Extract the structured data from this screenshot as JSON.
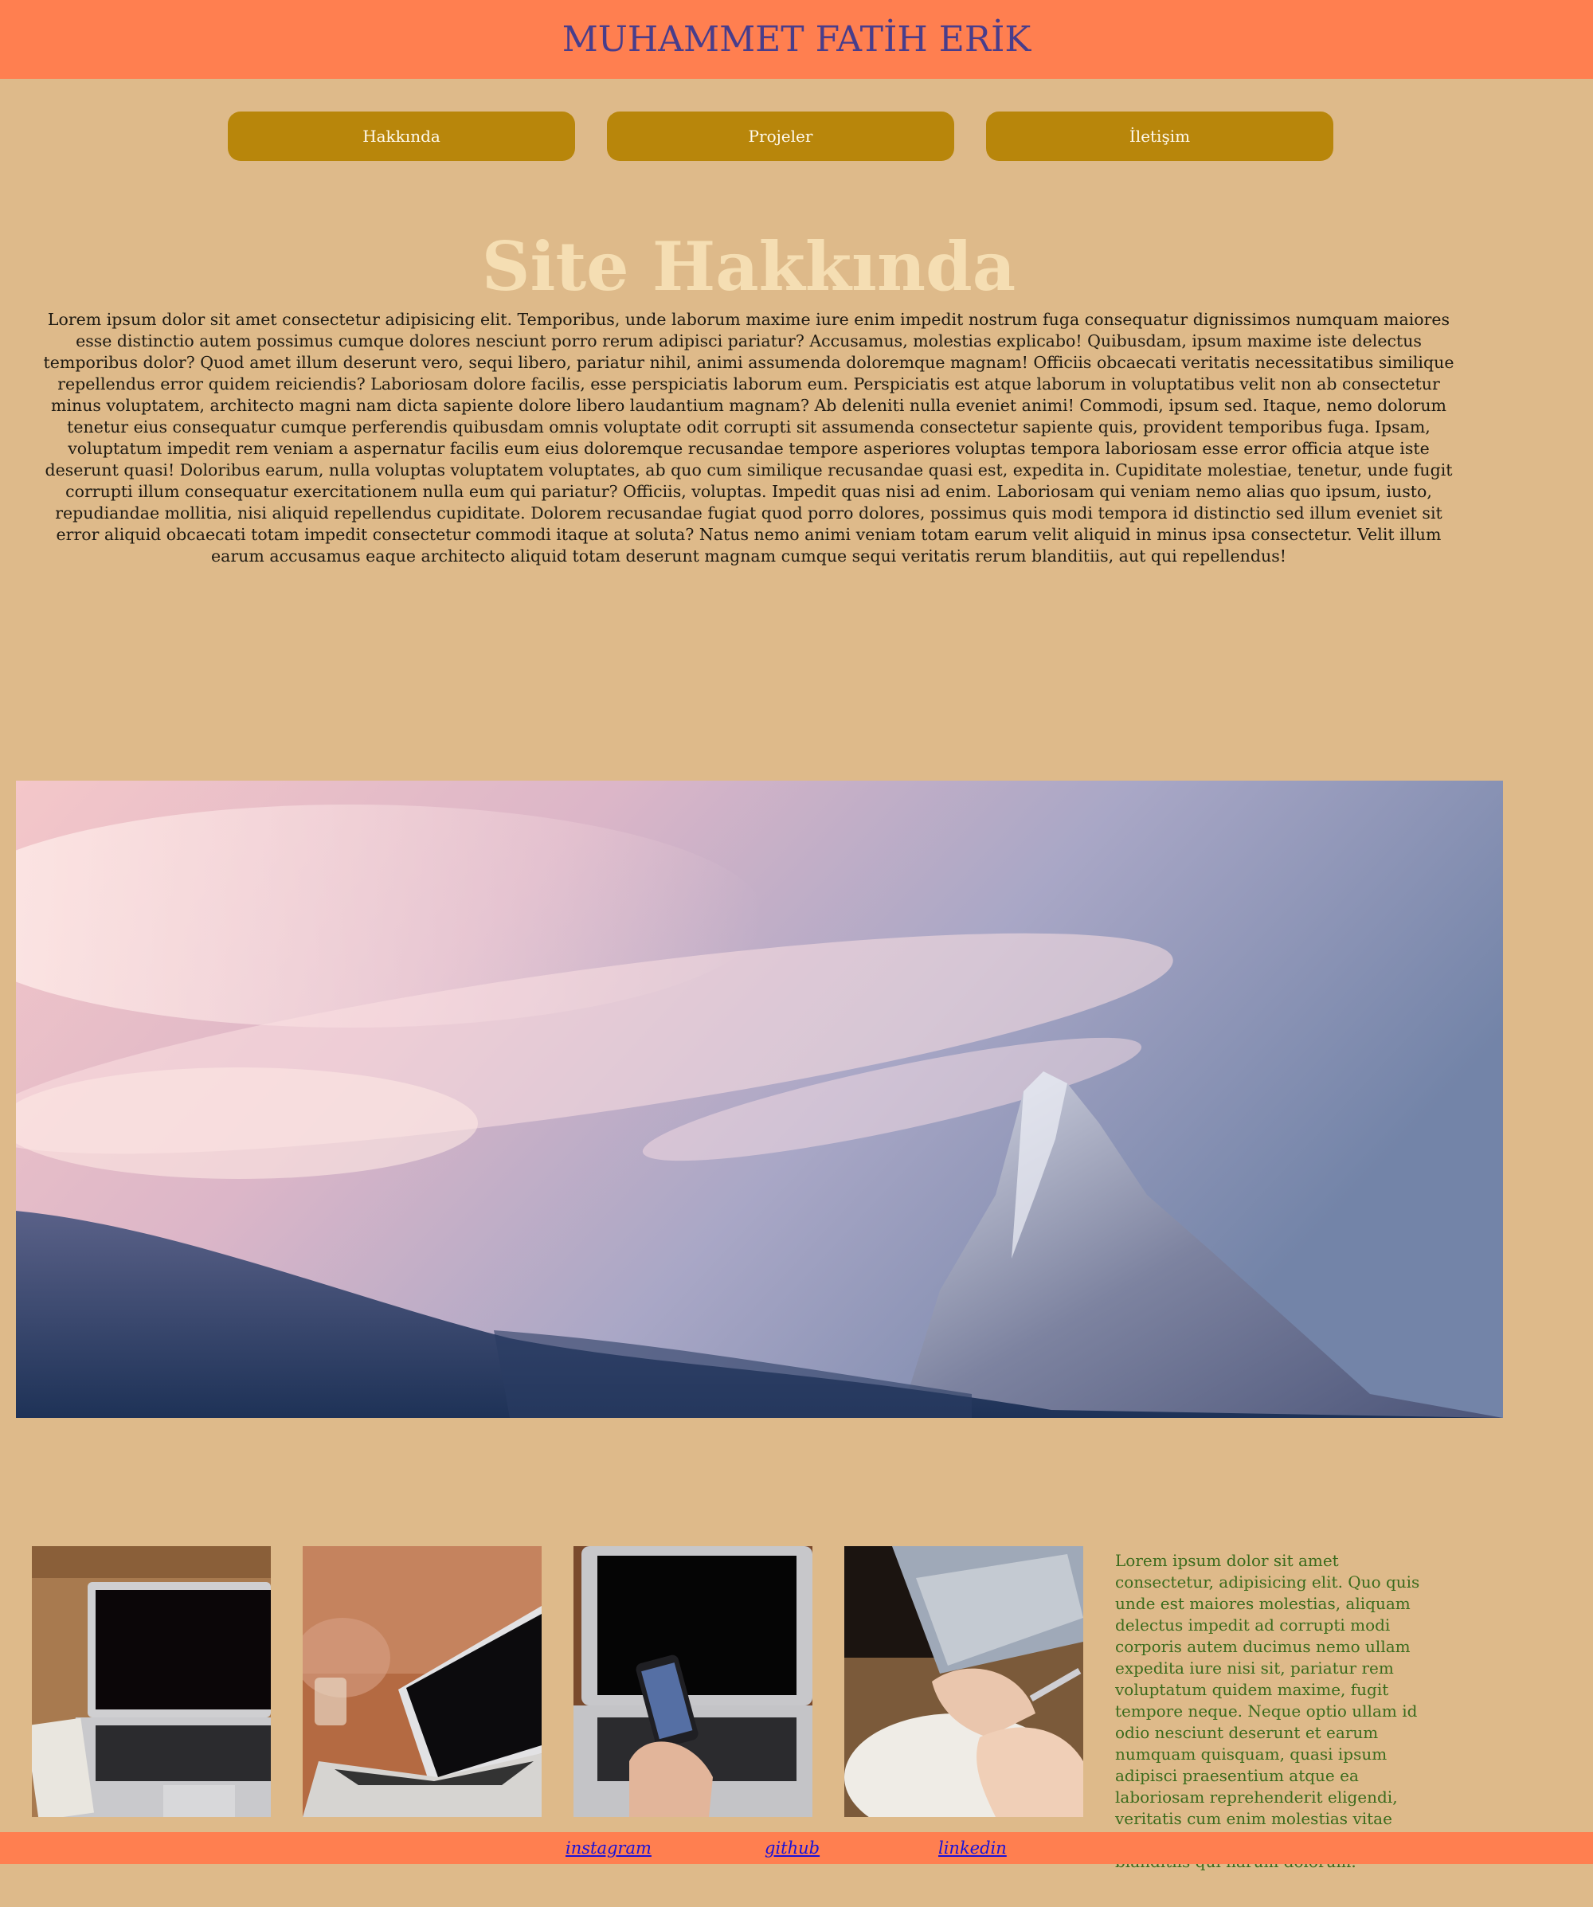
{
  "header": {
    "title": "MUHAMMET FATİH ERİK"
  },
  "nav": [
    {
      "label": "Hakkında"
    },
    {
      "label": "Projeler"
    },
    {
      "label": "İletişim"
    }
  ],
  "about": {
    "heading": "Site Hakkında",
    "body": "Lorem ipsum dolor sit amet consectetur adipisicing elit. Temporibus, unde laborum maxime iure enim impedit nostrum fuga consequatur dignissimos numquam maiores esse distinctio autem possimus cumque dolores nesciunt porro rerum adipisci pariatur? Accusamus, molestias explicabo! Quibusdam, ipsum maxime iste delectus temporibus dolor? Quod amet illum deserunt vero, sequi libero, pariatur nihil, animi assumenda doloremque magnam! Officiis obcaecati veritatis necessitatibus similique repellendus error quidem reiciendis? Laboriosam dolore facilis, esse perspiciatis laborum eum. Perspiciatis est atque laborum in voluptatibus velit non ab consectetur minus voluptatem, architecto magni nam dicta sapiente dolore libero laudantium magnam? Ab deleniti nulla eveniet animi! Commodi, ipsum sed. Itaque, nemo dolorum tenetur eius consequatur cumque perferendis quibusdam omnis voluptate odit corrupti sit assumenda consectetur sapiente quis, provident temporibus fuga. Ipsam, voluptatum impedit rem veniam a aspernatur facilis eum eius doloremque recusandae tempore asperiores voluptas tempora laboriosam esse error officia atque iste deserunt quasi! Doloribus earum, nulla voluptas voluptatem voluptates, ab quo cum similique recusandae quasi est, expedita in. Cupiditate molestiae, tenetur, unde fugit corrupti illum consequatur exercitationem nulla eum qui pariatur? Officiis, voluptas. Impedit quas nisi ad enim. Laboriosam qui veniam nemo alias quo ipsum, iusto, repudiandae mollitia, nisi aliquid repellendus cupiditate. Dolorem recusandae fugiat quod porro dolores, possimus quis modi tempora id distinctio sed illum eveniet sit error aliquid obcaecati totam impedit consectetur commodi itaque at soluta? Natus nemo animi veniam totam earum velit aliquid in minus ipsa consectetur. Velit illum earum accusamus eaque architecto aliquid totam deserunt magnam cumque sequi veritatis rerum blanditiis, aut qui repellendus!"
  },
  "gallery": {
    "side_text": "Lorem ipsum dolor sit amet consectetur, adipisicing elit. Quo quis unde est maiores molestias, aliquam delectus impedit ad corrupti modi corporis autem ducimus nemo ullam expedita iure nisi sit, pariatur rem voluptatum quidem maxime, fugit tempore neque. Neque optio ullam id odio nesciunt deserunt et earum numquam quisquam, quasi ipsum adipisci praesentium atque ea laboriosam reprehenderit eligendi, veritatis cum enim molestias vitae harum doloribus. Deserunt pariatur blanditiis qui harum dolorum."
  },
  "footer": {
    "links": [
      {
        "label": "instagram"
      },
      {
        "label": "github"
      },
      {
        "label": "linkedin"
      }
    ]
  },
  "colors": {
    "header_bg": "#FF7F50",
    "page_bg": "#DEBA8A",
    "title": "#483D8B",
    "nav_bg": "#B8860B",
    "heading": "#F5DEB3",
    "side_text": "#3A6B1C",
    "link": "#1A12D8"
  }
}
